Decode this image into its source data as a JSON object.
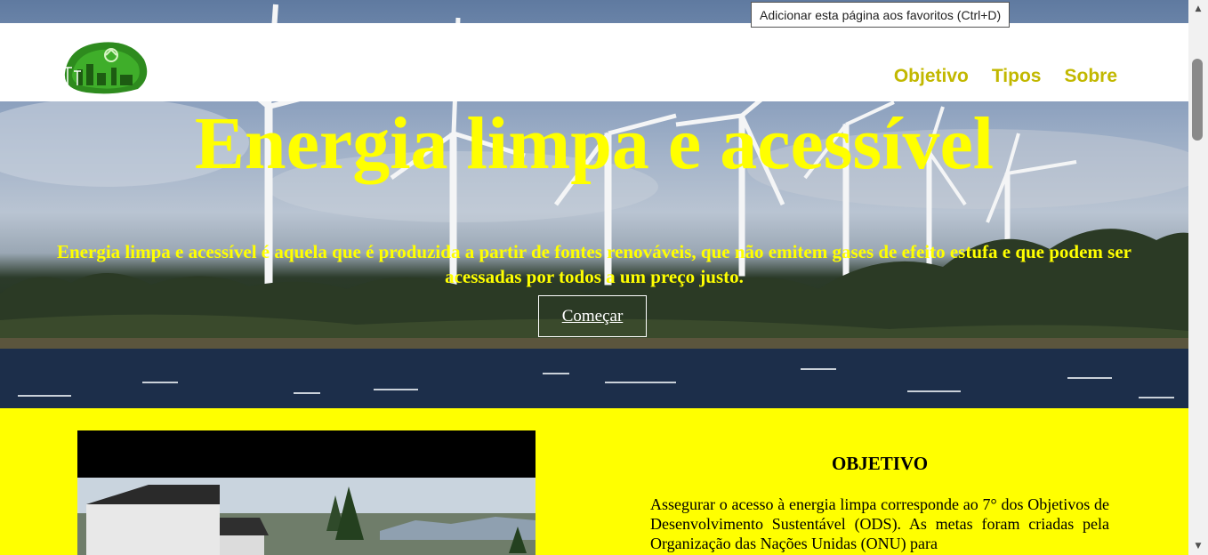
{
  "tooltip": {
    "text": "Adicionar esta página aos favoritos (Ctrl+D)"
  },
  "nav": {
    "items": [
      {
        "label": "Objetivo"
      },
      {
        "label": "Tipos"
      },
      {
        "label": "Sobre"
      }
    ]
  },
  "logo": {
    "icon": "recycle-icon"
  },
  "hero": {
    "title": "Energia limpa e acessível",
    "subtitle": "Energia limpa e acessível é aquela que é produzida a partir de fontes renováveis, que não emitem gases de efeito estufa e que podem ser acessadas por todos a um preço justo.",
    "cta_label": "Começar"
  },
  "objective": {
    "title": "OBJETIVO",
    "text": "Assegurar o acesso à energia limpa corresponde ao 7° dos Objetivos de Desenvolvimento Sustentável (ODS). As metas foram criadas pela Organização das Nações Unidas (ONU) para"
  },
  "colors": {
    "accent_yellow": "#ffff00",
    "nav_olive": "#c2b800",
    "logo_green": "#2e8b1e"
  }
}
